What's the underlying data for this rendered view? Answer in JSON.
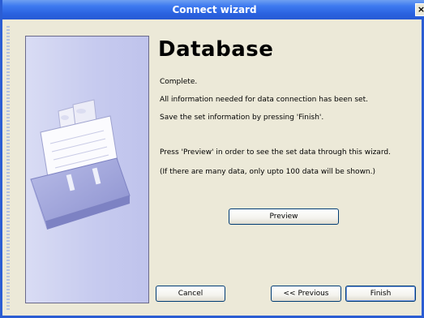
{
  "window": {
    "title": "Connect wizard",
    "close_label": "×"
  },
  "main": {
    "heading": "Database",
    "lines": [
      "Complete.",
      "All information needed for data connection has been set.",
      "Save the set information by pressing 'Finish'.",
      "Press 'Preview' in order to see the set data through this wizard.",
      "(If there are many data, only upto 100 data will be shown.)"
    ]
  },
  "buttons": {
    "preview": "Preview",
    "cancel": "Cancel",
    "previous": "<< Previous",
    "finish": "Finish"
  },
  "side_panel": {
    "image": "card-file-box-illustration"
  }
}
